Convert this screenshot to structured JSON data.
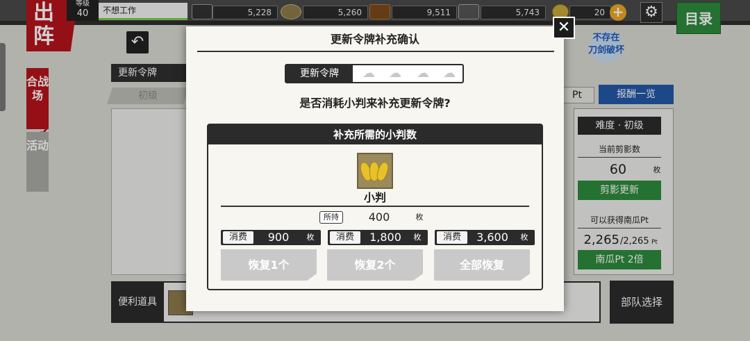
{
  "header": {
    "sortie": "出阵",
    "level_label": "等级",
    "level": "40",
    "player_name": "不想工作",
    "resources": [
      "5,228",
      "5,260",
      "9,511",
      "5,743"
    ],
    "koban": "20",
    "plus_icon": "+",
    "settings_icon": "gear-icon",
    "menu": "目录"
  },
  "sidebar": {
    "tab1": "合战场",
    "tab2": "活动"
  },
  "background": {
    "token_label": "更新令牌",
    "difficulty_tab": "初级",
    "items_label": "便利道具",
    "badge": "不存在\n刀剑破坏",
    "pt": "Pt",
    "reward_list": "报酬一览",
    "difficulty": "难度 · 初级",
    "current_shadow": "当前剪影数",
    "shadow_count": "60",
    "unit": "枚",
    "shadow_update": "剪影更新",
    "can_get": "可以获得南瓜Pt",
    "pt_value": "2,265",
    "pt_total": "/2,265",
    "pt_small": "Pt",
    "double_btn": "南瓜Pt 2倍",
    "team_select": "部队选择"
  },
  "modal": {
    "close_icon": "✕",
    "title": "更新令牌补充确认",
    "token_label": "更新令牌",
    "question": "是否消耗小判来补充更新令牌?",
    "required_header": "补充所需的小判数",
    "item_name": "小判",
    "owned_label": "所持",
    "owned_value": "400",
    "unit": "枚",
    "costs": [
      {
        "label": "消费",
        "value": "900",
        "unit": "枚"
      },
      {
        "label": "消费",
        "value": "1,800",
        "unit": "枚"
      },
      {
        "label": "消费",
        "value": "3,600",
        "unit": "枚"
      }
    ],
    "buttons": [
      "恢复1个",
      "恢复2个",
      "全部恢复"
    ]
  }
}
